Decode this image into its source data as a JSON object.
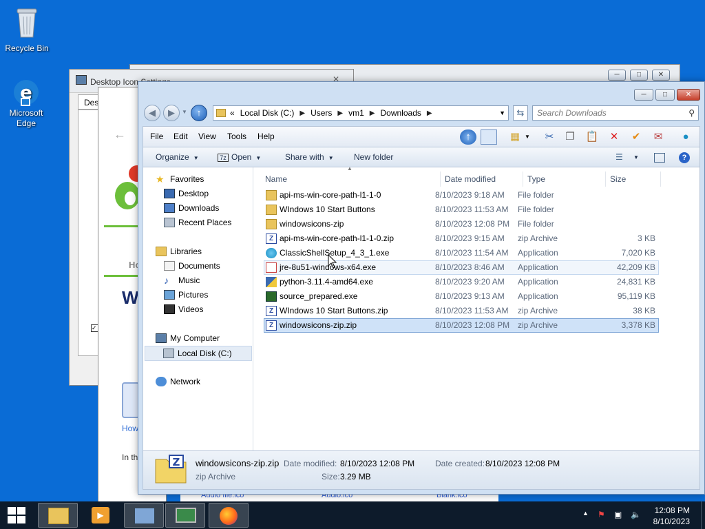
{
  "desktop": {
    "icons": [
      {
        "label": "Recycle Bin"
      },
      {
        "label": "Microsoft Edge"
      }
    ]
  },
  "background_windows": {
    "desktop_icon_settings_title": "Desktop Icon Settings",
    "desktop_icon_settings_tab": "Desk",
    "browser_fragments": [
      "Ho",
      "W",
      "How",
      "In th"
    ],
    "thumb_labels": [
      "Audio file.ico",
      "Audio.ico",
      "Blank.ico"
    ]
  },
  "explorer": {
    "breadcrumb": [
      "Local Disk (C:)",
      "Users",
      "vm1",
      "Downloads"
    ],
    "search_placeholder": "Search Downloads",
    "menu": [
      "File",
      "Edit",
      "View",
      "Tools",
      "Help"
    ],
    "commands": {
      "organize": "Organize",
      "open": "Open",
      "share_with": "Share with",
      "new_folder": "New folder"
    },
    "nav": {
      "favorites": "Favorites",
      "favorites_items": [
        "Desktop",
        "Downloads",
        "Recent Places"
      ],
      "libraries": "Libraries",
      "libraries_items": [
        "Documents",
        "Music",
        "Pictures",
        "Videos"
      ],
      "computer": "My Computer",
      "computer_items": [
        "Local Disk (C:)"
      ],
      "network": "Network"
    },
    "columns": {
      "name": "Name",
      "date": "Date modified",
      "type": "Type",
      "size": "Size"
    },
    "files": [
      {
        "name": "api-ms-win-core-path-l1-1-0",
        "date": "8/10/2023 9:18 AM",
        "type": "File folder",
        "size": "",
        "icon": "folder-icon"
      },
      {
        "name": "WIndows 10 Start Buttons",
        "date": "8/10/2023 11:53 AM",
        "type": "File folder",
        "size": "",
        "icon": "folder-icon"
      },
      {
        "name": "windowsicons-zip",
        "date": "8/10/2023 12:08 PM",
        "type": "File folder",
        "size": "",
        "icon": "folder-icon"
      },
      {
        "name": "api-ms-win-core-path-l1-1-0.zip",
        "date": "8/10/2023 9:15 AM",
        "type": "zip Archive",
        "size": "3 KB",
        "icon": "zip-icon"
      },
      {
        "name": "ClassicShellSetup_4_3_1.exe",
        "date": "8/10/2023 11:54 AM",
        "type": "Application",
        "size": "7,020 KB",
        "icon": "shell-icon"
      },
      {
        "name": "jre-8u51-windows-x64.exe",
        "date": "8/10/2023 8:46 AM",
        "type": "Application",
        "size": "42,209 KB",
        "icon": "java-icon"
      },
      {
        "name": "python-3.11.4-amd64.exe",
        "date": "8/10/2023 9:20 AM",
        "type": "Application",
        "size": "24,831 KB",
        "icon": "python-icon"
      },
      {
        "name": "source_prepared.exe",
        "date": "8/10/2023 9:13 AM",
        "type": "Application",
        "size": "95,119 KB",
        "icon": "exe-icon"
      },
      {
        "name": "WIndows 10 Start Buttons.zip",
        "date": "8/10/2023 11:53 AM",
        "type": "zip Archive",
        "size": "38 KB",
        "icon": "zip-icon"
      },
      {
        "name": "windowsicons-zip.zip",
        "date": "8/10/2023 12:08 PM",
        "type": "zip Archive",
        "size": "3,378 KB",
        "icon": "zip-icon"
      }
    ],
    "selected_index": 9,
    "hover_index": 5,
    "details": {
      "name": "windowsicons-zip.zip",
      "type": "zip Archive",
      "modified_label": "Date modified:",
      "modified_value": "8/10/2023 12:08 PM",
      "created_label": "Date created:",
      "created_value": "8/10/2023 12:08 PM",
      "size_label": "Size:",
      "size_value": "3.29 MB"
    }
  },
  "taskbar": {
    "time": "12:08 PM",
    "date": "8/10/2023"
  },
  "colors": {
    "desktop": "#0a6cd6",
    "selection": "#cfe2f8",
    "taskbar": "#0d1b2b"
  }
}
